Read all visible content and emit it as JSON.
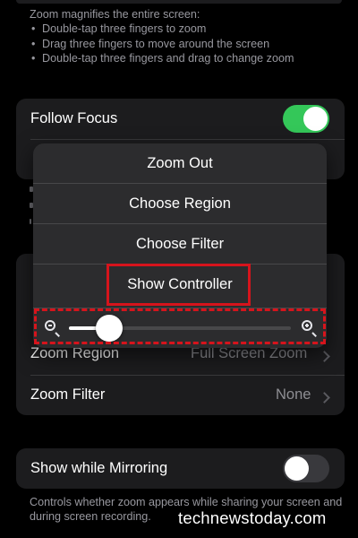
{
  "intro": {
    "heading": "Zoom magnifies the entire screen:",
    "bullets": [
      "Double-tap three fingers to zoom",
      "Drag three fingers to move around the screen",
      "Double-tap three fingers and drag to change zoom"
    ]
  },
  "follow_focus": {
    "label": "Follow Focus",
    "on": true
  },
  "menu": {
    "items": [
      "Zoom Out",
      "Choose Region",
      "Choose Filter",
      "Show Controller"
    ],
    "slider": {
      "value": 0.18
    }
  },
  "settings": {
    "zoom_region": {
      "label": "Zoom Region",
      "value": "Full Screen Zoom"
    },
    "zoom_filter": {
      "label": "Zoom Filter",
      "value": "None"
    }
  },
  "mirroring": {
    "label": "Show while Mirroring",
    "on": false,
    "footer": "Controls whether zoom appears while sharing your screen and during screen recording."
  },
  "watermark": "technewstoday.com",
  "colors": {
    "toggle_on": "#34c759",
    "toggle_off": "#39393d",
    "highlight": "#d6141c",
    "card_bg": "#1c1c1e",
    "menu_bg": "#2c2c2e"
  }
}
